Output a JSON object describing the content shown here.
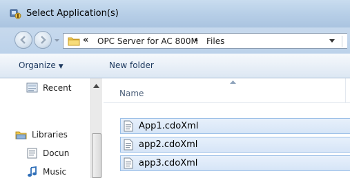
{
  "window": {
    "title": "Select Application(s)"
  },
  "address": {
    "overflow_chevron": "«",
    "crumbs": [
      "OPC Server for AC 800M",
      "Files"
    ],
    "separator": "▸"
  },
  "toolbar": {
    "organize_label": "Organize",
    "organize_arrow": "▼",
    "new_folder_label": "New folder"
  },
  "nav_pane": {
    "items": [
      {
        "label": "Recent",
        "icon": "recent-places-icon"
      },
      {
        "label": "Libraries",
        "icon": "libraries-icon"
      },
      {
        "label": "Docun",
        "icon": "documents-icon"
      },
      {
        "label": "Music",
        "icon": "music-icon"
      }
    ]
  },
  "file_list": {
    "column_name": "Name",
    "files": [
      "App1.cdoXml",
      "app2.cdoXml",
      "app3.cdoXml"
    ]
  },
  "colors": {
    "selection_fill": "#d6e5f7",
    "selection_border": "#9bbfe7",
    "toolbar_text": "#1e3a5f"
  }
}
